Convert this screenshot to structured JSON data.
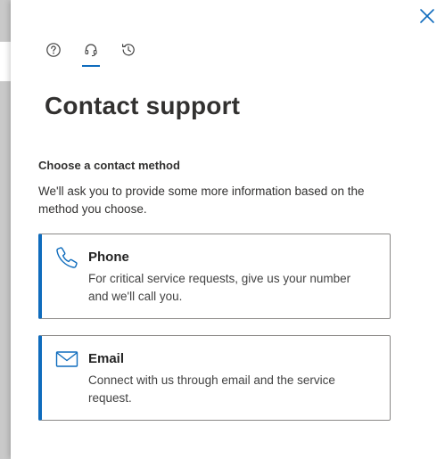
{
  "panel": {
    "title": "Contact support",
    "tabs": [
      {
        "name": "help",
        "icon": "help-circle-icon",
        "selected": false
      },
      {
        "name": "contact-support",
        "icon": "headset-icon",
        "selected": true
      },
      {
        "name": "history",
        "icon": "history-icon",
        "selected": false
      }
    ],
    "close_icon": "close-icon"
  },
  "contact": {
    "heading": "Choose a contact method",
    "description": "We'll ask you to provide some more information based on the method you choose.",
    "methods": [
      {
        "title": "Phone",
        "description": "For critical service requests, give us your number and we'll call you.",
        "icon": "phone-icon"
      },
      {
        "title": "Email",
        "description": "Connect with us through email and the service request.",
        "icon": "mail-icon"
      }
    ]
  },
  "colors": {
    "accent": "#0f6cbd",
    "text": "#323130",
    "border": "#8a8886"
  }
}
